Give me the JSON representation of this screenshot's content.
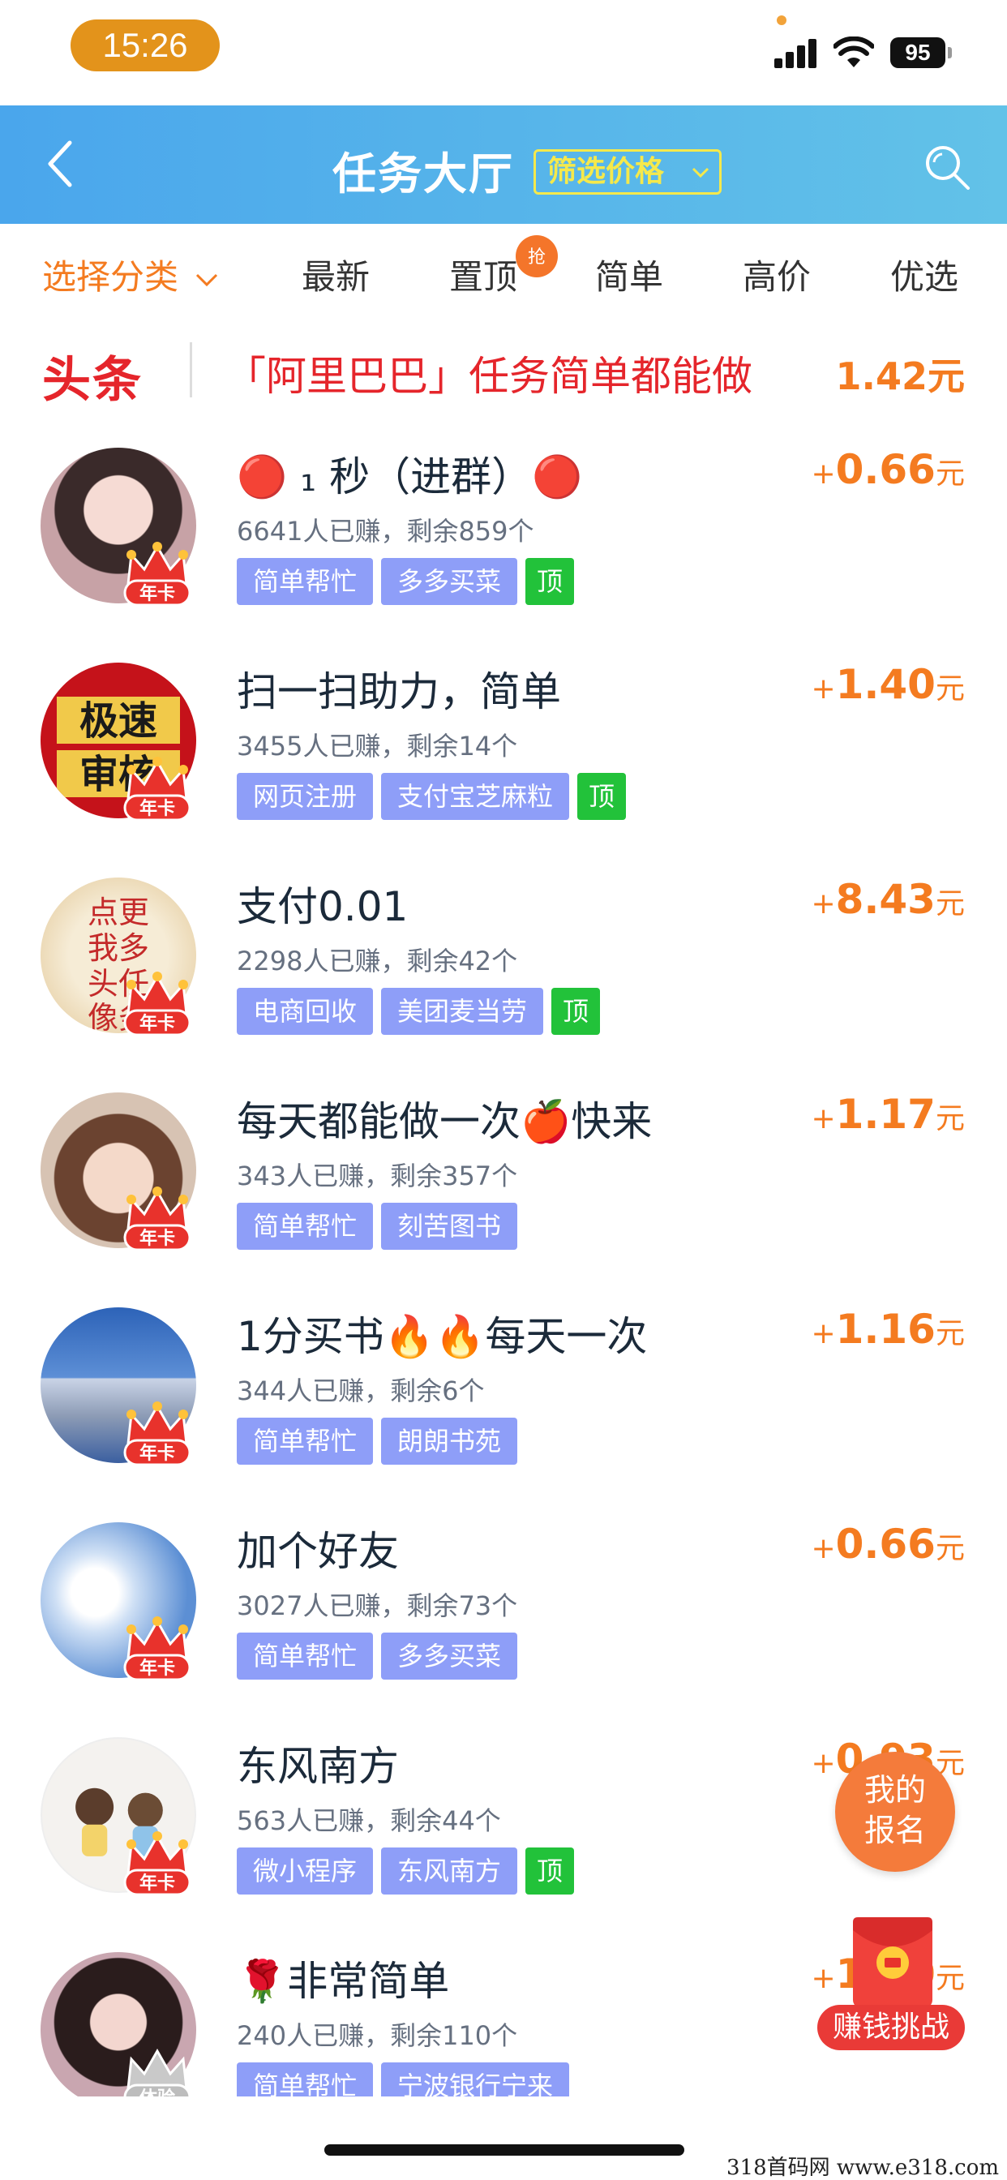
{
  "status_bar": {
    "time": "15:26",
    "battery": "95"
  },
  "header": {
    "title": "任务大厅",
    "filter_label": "筛选价格"
  },
  "tabs": [
    {
      "label": "选择分类",
      "active": true
    },
    {
      "label": "最新"
    },
    {
      "label": "置顶",
      "badge": "抢"
    },
    {
      "label": "简单"
    },
    {
      "label": "高价"
    },
    {
      "label": "优选"
    }
  ],
  "headline": {
    "tag": "头条",
    "text": "「阿里巴巴」任务简单都能做",
    "price": "1.42元"
  },
  "tasks": [
    {
      "title": "🔴 ₁ 秒（进群）🔴",
      "meta": "6641人已赚，剩余859个",
      "tags": [
        "简单帮忙",
        "多多买菜"
      ],
      "top": "顶",
      "price": "0.66",
      "vip": "年卡"
    },
    {
      "title": "扫一扫助力，简单",
      "meta": "3455人已赚，剩余14个",
      "tags": [
        "网页注册",
        "支付宝芝麻粒"
      ],
      "top": "顶",
      "price": "1.40",
      "vip": "年卡",
      "avatar_text": [
        "极速",
        "审核"
      ]
    },
    {
      "title": "支付0.01",
      "meta": "2298人已赚，剩余42个",
      "tags": [
        "电商回收",
        "美团麦当劳"
      ],
      "top": "顶",
      "price": "8.43",
      "vip": "年卡",
      "avatar_text": [
        "点更",
        "我多",
        "头任",
        "像务"
      ]
    },
    {
      "title": "每天都能做一次🍎快来",
      "meta": "343人已赚，剩余357个",
      "tags": [
        "简单帮忙",
        "刻苦图书"
      ],
      "price": "1.17",
      "vip": "年卡"
    },
    {
      "title": "1分买书🔥🔥每天一次",
      "meta": "344人已赚，剩余6个",
      "tags": [
        "简单帮忙",
        "朗朗书苑"
      ],
      "price": "1.16",
      "vip": "年卡"
    },
    {
      "title": "加个好友",
      "meta": "3027人已赚，剩余73个",
      "tags": [
        "简单帮忙",
        "多多买菜"
      ],
      "price": "0.66",
      "vip": "年卡"
    },
    {
      "title": "东风南方",
      "meta": "563人已赚，剩余44个",
      "tags": [
        "微小程序",
        "东风南方"
      ],
      "top": "顶",
      "price": "0.93",
      "vip": "年卡"
    },
    {
      "title": "🌹非常简单",
      "meta": "240人已赚，剩余110个",
      "tags": [
        "简单帮忙",
        "宁波银行宁来"
      ],
      "price": "1.10",
      "vip": "体验"
    }
  ],
  "price_prefix": "+",
  "price_unit": "元",
  "fab": {
    "signup_line1": "我的",
    "signup_line2": "报名",
    "challenge": "赚钱挑战"
  },
  "watermark": "318首码网  www.e318.com",
  "colors": {
    "accent": "#f47b20",
    "header": "#4aa6ec",
    "tag": "#8e9ef8",
    "top_tag": "#22c23a",
    "headline": "#e5252b"
  }
}
